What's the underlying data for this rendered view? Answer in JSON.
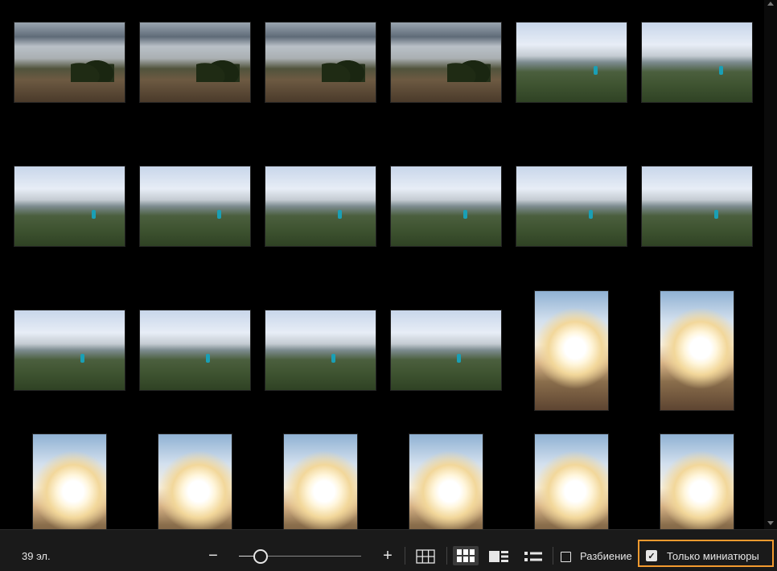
{
  "status": {
    "item_count": "39 эл."
  },
  "zoom": {
    "out_label": "−",
    "in_label": "+",
    "level": 0.17
  },
  "view_modes": [
    "grid-large-icon",
    "grid-small-icon",
    "filmstrip-icon",
    "list-icon"
  ],
  "options": {
    "split_label": "Разбиение",
    "split_checked": false,
    "thumbs_only_label": "Только миниатюры",
    "thumbs_only_checked": true,
    "check_mark": "✓"
  },
  "colors": {
    "highlight": "#f39a2f",
    "background": "#000000",
    "toolbar": "#1a1a1a",
    "text": "#e6e6e6"
  },
  "thumbnails": [
    {
      "kind": "landscape-dusk"
    },
    {
      "kind": "landscape-dusk"
    },
    {
      "kind": "landscape-dusk"
    },
    {
      "kind": "landscape-dusk"
    },
    {
      "kind": "landscape-valley"
    },
    {
      "kind": "landscape-valley"
    },
    {
      "kind": "landscape-valley"
    },
    {
      "kind": "landscape-valley"
    },
    {
      "kind": "landscape-valley"
    },
    {
      "kind": "landscape-valley"
    },
    {
      "kind": "landscape-valley"
    },
    {
      "kind": "landscape-valley"
    },
    {
      "kind": "landscape-valley"
    },
    {
      "kind": "landscape-valley"
    },
    {
      "kind": "landscape-valley"
    },
    {
      "kind": "landscape-valley"
    },
    {
      "kind": "portrait-sun"
    },
    {
      "kind": "portrait-sun"
    },
    {
      "kind": "portrait-sun"
    },
    {
      "kind": "portrait-sun"
    },
    {
      "kind": "portrait-sun"
    },
    {
      "kind": "portrait-sun"
    },
    {
      "kind": "portrait-sun"
    },
    {
      "kind": "portrait-sun"
    }
  ]
}
